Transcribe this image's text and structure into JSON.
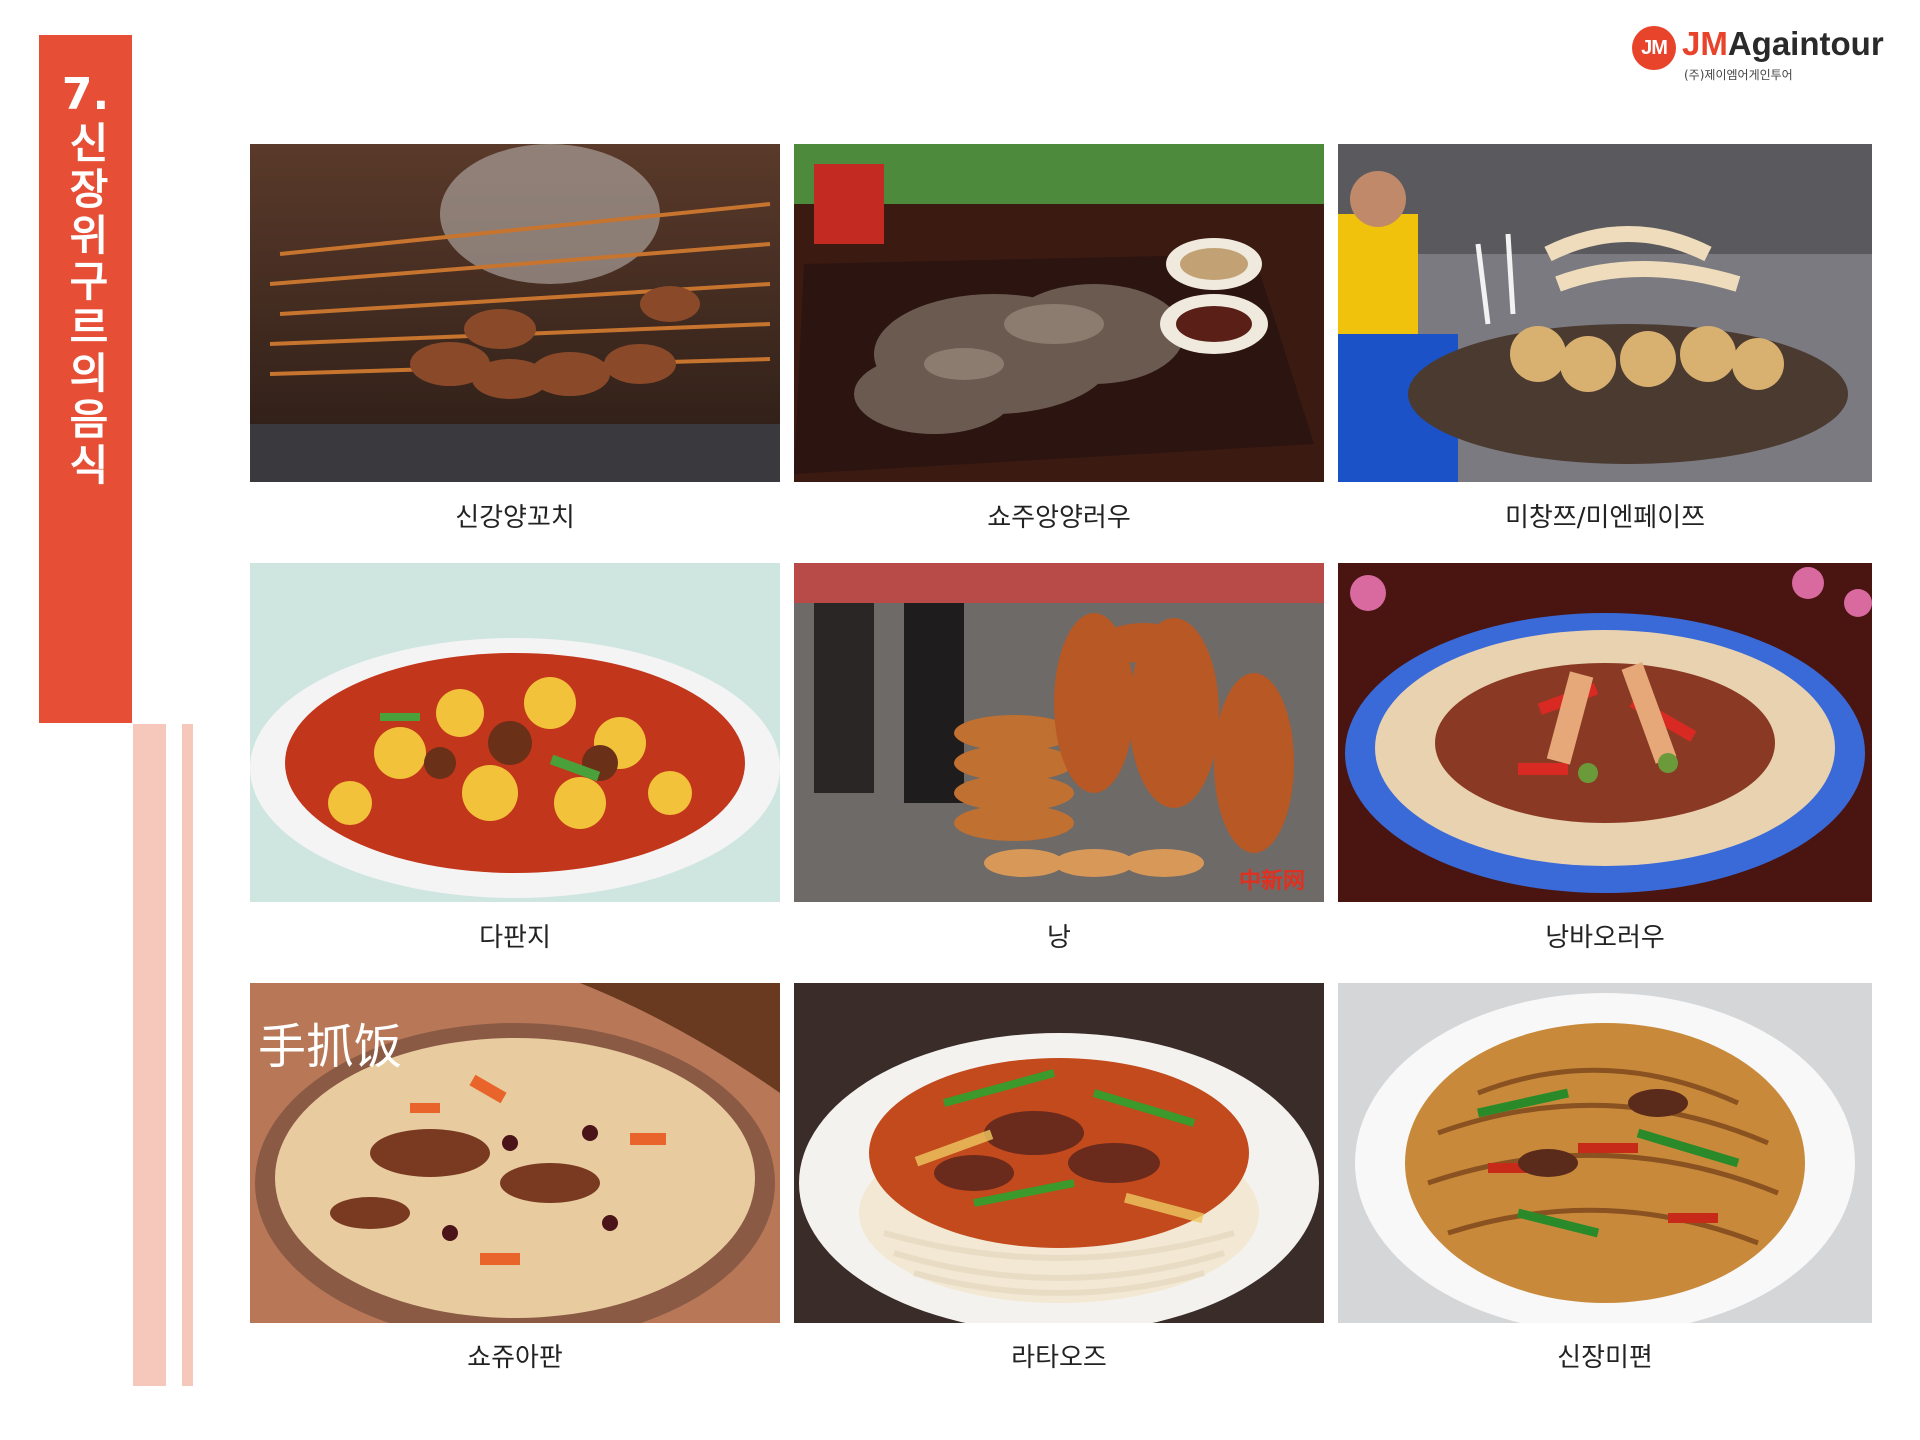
{
  "slide": {
    "number": "7.",
    "title": "신장위구르의음식"
  },
  "logo": {
    "mark": "JM",
    "brand_prefix": "JM",
    "brand_suffix": "Againtour",
    "subtitle": "(주)제이엠어게인투어"
  },
  "dishes": [
    {
      "name": "신강양꼬치",
      "photo_overlay": ""
    },
    {
      "name": "쇼주앙양러우",
      "photo_overlay": ""
    },
    {
      "name": "미창쯔/미엔페이쯔",
      "photo_overlay": ""
    },
    {
      "name": "다판지",
      "photo_overlay": ""
    },
    {
      "name": "낭",
      "photo_overlay": "中新网"
    },
    {
      "name": "낭바오러우",
      "photo_overlay": ""
    },
    {
      "name": "쇼쥬아판",
      "photo_overlay": "手抓饭"
    },
    {
      "name": "라타오즈",
      "photo_overlay": ""
    },
    {
      "name": "신장미편",
      "photo_overlay": ""
    }
  ],
  "colors": {
    "accent": "#e64e36",
    "accent_light": "#f6c8bc",
    "logo_red": "#e8432b"
  }
}
